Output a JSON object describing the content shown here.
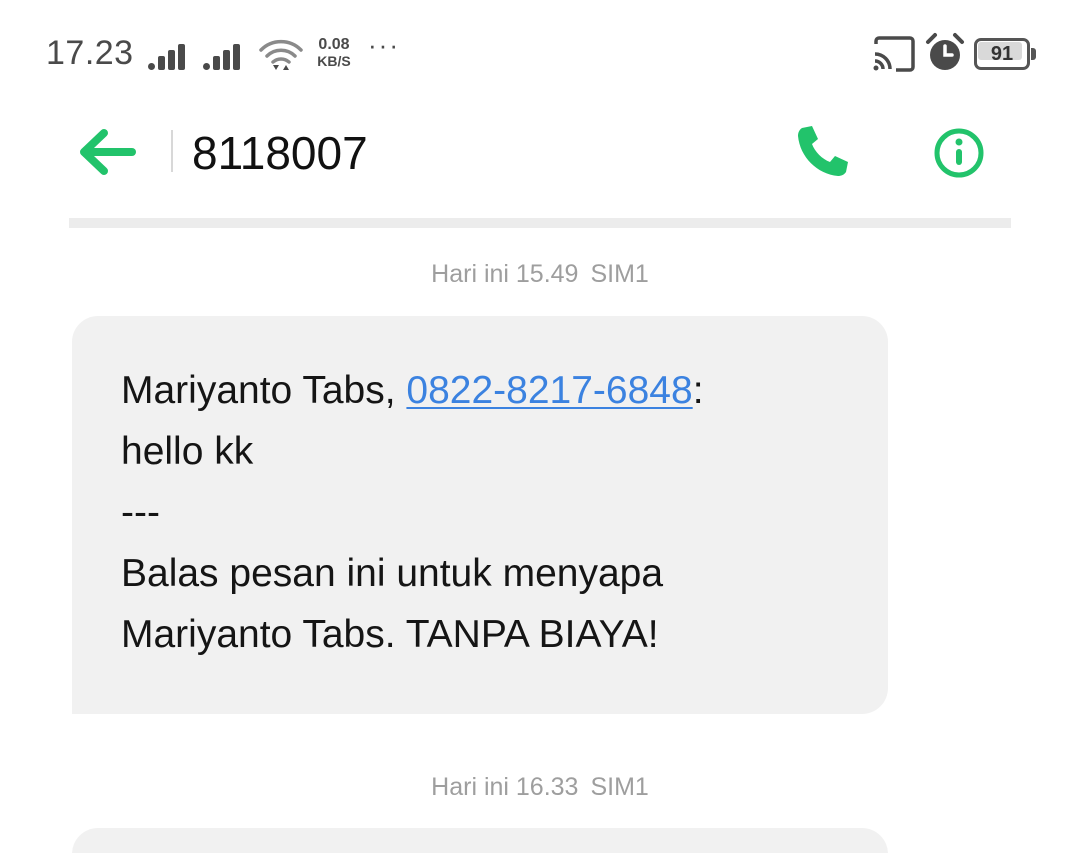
{
  "status_bar": {
    "time": "17.23",
    "net_speed_value": "0.08",
    "net_speed_unit": "KB/S",
    "more": "···",
    "battery_level": "91",
    "icons": [
      "signal-sim1-icon",
      "signal-sim2-icon",
      "wifi-icon",
      "cast-icon",
      "alarm-icon",
      "battery-icon"
    ]
  },
  "header": {
    "title": "8118007",
    "back_icon": "arrow-left-icon",
    "call_icon": "phone-icon",
    "info_icon": "info-icon"
  },
  "colors": {
    "accent": "#22c36b",
    "link": "#3b82e0",
    "bubble_bg": "#f1f1f1",
    "timestamp": "#9e9e9e"
  },
  "messages": [
    {
      "time": "Hari ini 15.49",
      "sim": "SIM1",
      "sender_prefix": "Mariyanto Tabs, ",
      "phone": "0822-8217-6848",
      "sender_suffix": ":",
      "text_line_1": "hello kk",
      "separator": "---",
      "text_line_2": "Balas pesan ini untuk menyapa",
      "text_line_3": "Mariyanto Tabs. TANPA BIAYA!"
    },
    {
      "time": "Hari ini 16.33",
      "sim": "SIM1"
    }
  ]
}
